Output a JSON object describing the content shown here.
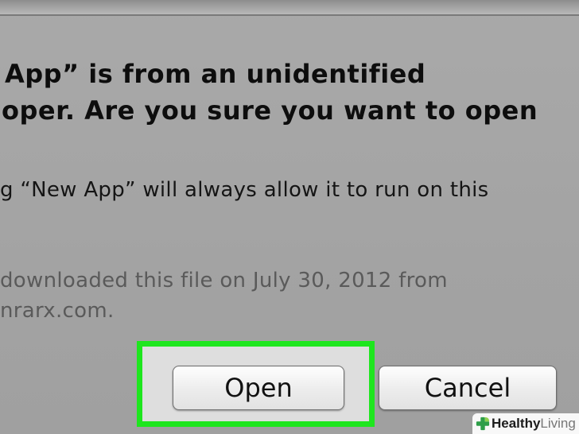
{
  "dialog": {
    "title_lines": [
      "App” is from an unidentified",
      "oper. Are you sure you want to open"
    ],
    "body_text": "g “New App” will always allow it to run on this",
    "info_lines": [
      "downloaded this file on July 30, 2012 from",
      "nrarx.com."
    ],
    "buttons": {
      "open_label": "Open",
      "cancel_label": "Cancel"
    }
  },
  "highlight_color": "#1ee61e",
  "watermark": {
    "brand_bold": "Healthy",
    "brand_light": "Living",
    "icon": "leaf-cross-icon"
  }
}
